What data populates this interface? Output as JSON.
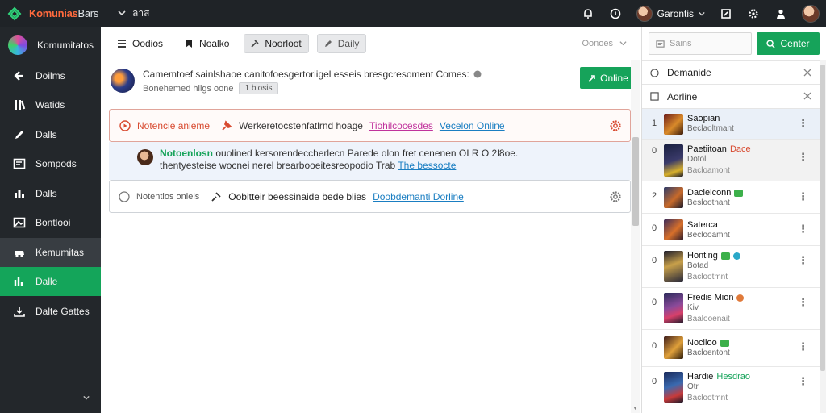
{
  "topbar": {
    "brand_a": "Komunias",
    "brand_b": "Bars",
    "workspace": "ลาส",
    "user_name": "Garontis"
  },
  "sidebar": {
    "items": [
      {
        "label": "Komumitatos",
        "icon": "server-avatar"
      },
      {
        "label": "Doilms",
        "icon": "arrow-left-icon"
      },
      {
        "label": "Watids",
        "icon": "library-icon"
      },
      {
        "label": "Dalls",
        "icon": "pencil-icon"
      },
      {
        "label": "Sompods",
        "icon": "terminal-icon"
      },
      {
        "label": "Dalls",
        "icon": "chart-icon"
      },
      {
        "label": "Bontlooi",
        "icon": "image-icon"
      },
      {
        "label": "Kemumitas",
        "icon": "car-icon"
      },
      {
        "label": "Dalle",
        "icon": "stats-icon"
      },
      {
        "label": "Dalte Gattes",
        "icon": "import-icon"
      }
    ]
  },
  "toolbar": {
    "btn1": "Oodios",
    "btn2": "Noalko",
    "btn3": "Noorloot",
    "btn4": "Daily",
    "right": "Oonoes"
  },
  "conversation": {
    "title": "Camemtoef sainlshaoe canitofoesgertoriigel esseis bresgcresoment Comes:",
    "subtitle": "Bonehemed hiigs oone",
    "tag": "1 blosis",
    "online_btn": "Online"
  },
  "alert": {
    "label": "Notencie anieme",
    "message": "Werkeretocstenfatlrnd hoage",
    "link1": "Tiohilcocesdes",
    "link2": "Vecelon Online"
  },
  "reply": {
    "name": "Notoenlosn",
    "text1": "ouolined kersorendeccherlecn Parede olon fret cenenen OI R O 2l8oe.",
    "text2": "thentyesteise wocnei nerel brearbooeitesreopodio",
    "text2b": "Trab",
    "link": "The bessocte"
  },
  "notice": {
    "label": "Notentios onleis",
    "message": "Oobitteir beessinaide bede blies",
    "link": "Doobdemanti Dorline"
  },
  "rpanel": {
    "search_placeholder": "Sains",
    "center_btn": "Center",
    "filter1": "Demanide",
    "filter2": "Aorline",
    "players": [
      {
        "num": "1",
        "name": "Saopian",
        "sub": "Beclaoltmant"
      },
      {
        "num": "0",
        "name": "Paetiitoan",
        "extra": "Dace",
        "sub": "Dotol",
        "sub2": "Bacloamont"
      },
      {
        "num": "2",
        "name": "Dacleiconn",
        "sub": "Beslootnant"
      },
      {
        "num": "0",
        "name": "Saterca",
        "sub": "Beclooamnt"
      },
      {
        "num": "0",
        "name": "Honting",
        "sub": "Botad",
        "sub2": "Baclootmnt"
      },
      {
        "num": "0",
        "name": "Fredis Mion",
        "sub": "Kiv",
        "sub2": "Baalooenait"
      },
      {
        "num": "0",
        "name": "Noclioo",
        "sub": "Bacloentont"
      },
      {
        "num": "0",
        "name": "Hardie",
        "extra": "Hesdrao",
        "sub": "Otr",
        "sub2": "Baclootmnt"
      }
    ]
  },
  "colors": {
    "accent_green": "#16a35a",
    "sidebar_bg": "#23272b",
    "alert_red": "#d84a30",
    "link_blue": "#1a7ec2"
  }
}
